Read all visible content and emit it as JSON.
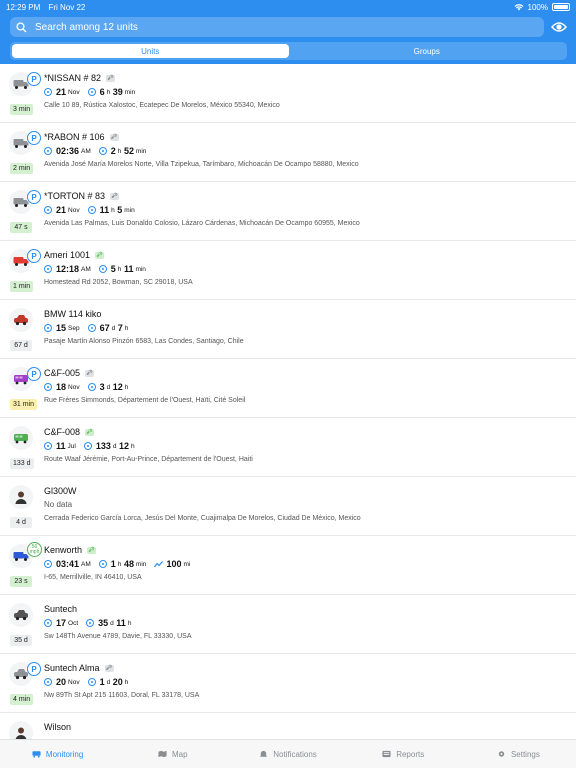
{
  "status_bar": {
    "time": "12:29 PM",
    "date": "Fri Nov 22",
    "battery": "100%"
  },
  "search": {
    "placeholder": "Search among 12 units"
  },
  "segments": [
    "Units",
    "Groups"
  ],
  "units": [
    {
      "name": "*NISSAN # 82",
      "key": "gray",
      "badge": "P",
      "d1": "21",
      "d1s": "Nov",
      "d2": "6",
      "d2s": "h",
      "d3": "39",
      "d3s": "min",
      "address": "Calle 10 89, Rústica Xalostoc, Ecatepec De Morelos, México 55340, Mexico",
      "age": "3 min",
      "age_color": "green",
      "icon": "truck-icon",
      "icon_color": "#8e9196"
    },
    {
      "name": "*RABON # 106",
      "key": "gray",
      "badge": "P",
      "d1": "02:36",
      "d1s": "AM",
      "d2": "2",
      "d2s": "h",
      "d3": "52",
      "d3s": "min",
      "address": "Avenida José María Morelos Norte, Villa Tzipekua, Tarímbaro, Michoacán De Ocampo 58880, Mexico",
      "age": "2 min",
      "age_color": "green",
      "icon": "truck-icon",
      "icon_color": "#8e9196"
    },
    {
      "name": "*TORTON # 83",
      "key": "gray",
      "badge": "P",
      "d1": "21",
      "d1s": "Nov",
      "d2": "11",
      "d2s": "h",
      "d3": "5",
      "d3s": "min",
      "address": "Avenida Las Palmas, Luis Donaldo Colosio, Lázaro Cárdenas, Michoacán De Ocampo 60955, Mexico",
      "age": "47 s",
      "age_color": "green",
      "icon": "truck-icon",
      "icon_color": "#8e9196"
    },
    {
      "name": "Ameri 1001",
      "key": "green",
      "badge": "P",
      "d1": "12:18",
      "d1s": "AM",
      "d2": "5",
      "d2s": "h",
      "d3": "11",
      "d3s": "min",
      "address": "Homestead Rd 2052, Bowman, SC 29018, USA",
      "age": "1 min",
      "age_color": "green",
      "icon": "truck-icon",
      "icon_color": "#e03b2e"
    },
    {
      "name": "BMW 114 kiko",
      "key": "",
      "badge": "",
      "d1": "15",
      "d1s": "Sep",
      "d2": "67",
      "d2s": "d",
      "d3": "7",
      "d3s": "h",
      "address": "Pasaje Martín Alonso Pinzón 6583, Las Condes, Santiago, Chile",
      "age": "67 d",
      "age_color": "gray",
      "icon": "car-icon",
      "icon_color": "#c0392b"
    },
    {
      "name": "C&F-005",
      "key": "gray",
      "badge": "P",
      "d1": "18",
      "d1s": "Nov",
      "d2": "3",
      "d2s": "d",
      "d3": "12",
      "d3s": "h",
      "address": "Rue Frères Simmonds, Département de l'Ouest, Haïti, Cité Soleil",
      "age": "31 min",
      "age_color": "yellow",
      "icon": "bus-icon",
      "icon_color": "#a33fc8"
    },
    {
      "name": "C&F-008",
      "key": "green",
      "badge": "",
      "d1": "11",
      "d1s": "Jul",
      "d2": "133",
      "d2s": "d",
      "d3": "12",
      "d3s": "h",
      "address": "Route Waaf Jérémie, Port-Au-Prince, Département de l'Ouest, Haiti",
      "age": "133 d",
      "age_color": "gray",
      "icon": "bus-icon",
      "icon_color": "#4caf50"
    },
    {
      "name": "Gl300W",
      "key": "",
      "badge": "",
      "nodata": "No data",
      "address": "Cerrada Federico García Lorca, Jesús Del Monte, Cuajimalpa De Morelos, Ciudad De México, Mexico",
      "age": "4 d",
      "age_color": "gray",
      "icon": "person-icon",
      "icon_color": "#333333"
    },
    {
      "name": "Kenworth",
      "key": "green",
      "badge": "speed",
      "speed_top": "56",
      "speed_bottom": "mph",
      "d1": "03:41",
      "d1s": "AM",
      "d2": "1",
      "d2s": "h",
      "d3": "48",
      "d3s": "min",
      "d4": "100",
      "d4s": "mi",
      "address": "I-65, Merrillville, IN 46410, USA",
      "age": "23 s",
      "age_color": "green",
      "icon": "truck-icon",
      "icon_color": "#2d5bd8"
    },
    {
      "name": "Suntech",
      "key": "",
      "badge": "",
      "d1": "17",
      "d1s": "Oct",
      "d2": "35",
      "d2s": "d",
      "d3": "11",
      "d3s": "h",
      "address": "Sw 148Th Avenue 4789, Davie, FL 33330, USA",
      "age": "35 d",
      "age_color": "gray",
      "icon": "car-icon",
      "icon_color": "#555555"
    },
    {
      "name": "Suntech Alma",
      "key": "gray",
      "badge": "P",
      "d1": "20",
      "d1s": "Nov",
      "d2": "1",
      "d2s": "d",
      "d3": "20",
      "d3s": "h",
      "address": "Nw 89Th St Apt 215 11603, Doral, FL 33178, USA",
      "age": "4 min",
      "age_color": "green",
      "icon": "car-icon",
      "icon_color": "#8e9196"
    },
    {
      "name": "Wilson",
      "key": "",
      "badge": "",
      "address": "",
      "age": "",
      "age_color": "gray",
      "icon": "person-icon",
      "icon_color": "#333333"
    }
  ],
  "tabs": [
    {
      "label": "Monitoring",
      "icon": "monitoring-icon",
      "active": true
    },
    {
      "label": "Map",
      "icon": "map-icon",
      "active": false
    },
    {
      "label": "Notifications",
      "icon": "bell-icon",
      "active": false
    },
    {
      "label": "Reports",
      "icon": "reports-icon",
      "active": false
    },
    {
      "label": "Settings",
      "icon": "gear-icon",
      "active": false
    }
  ],
  "colors": {
    "accent": "#2d8ef0"
  }
}
